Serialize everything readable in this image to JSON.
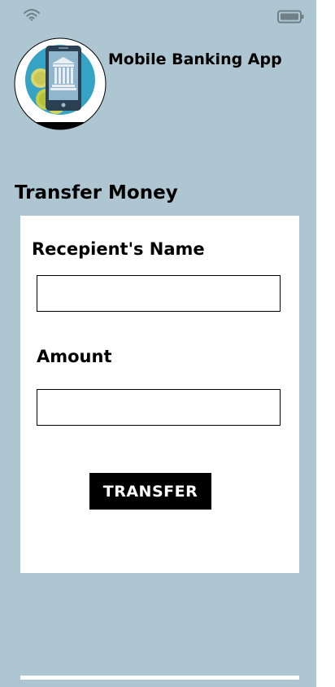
{
  "status_bar": {
    "wifi_icon": "wifi-icon",
    "battery_icon": "battery-icon"
  },
  "header": {
    "logo_icon": "bank-phone-logo-icon",
    "app_title": "Mobile Banking App"
  },
  "page": {
    "title": "Transfer Money"
  },
  "form": {
    "recipient_label": "Recepient's Name",
    "recipient_value": "",
    "amount_label": "Amount",
    "amount_value": "",
    "submit_label": "TRANSFER"
  },
  "colors": {
    "background": "#adc6d1",
    "card": "#ffffff",
    "button": "#000000",
    "button_text": "#ffffff"
  }
}
